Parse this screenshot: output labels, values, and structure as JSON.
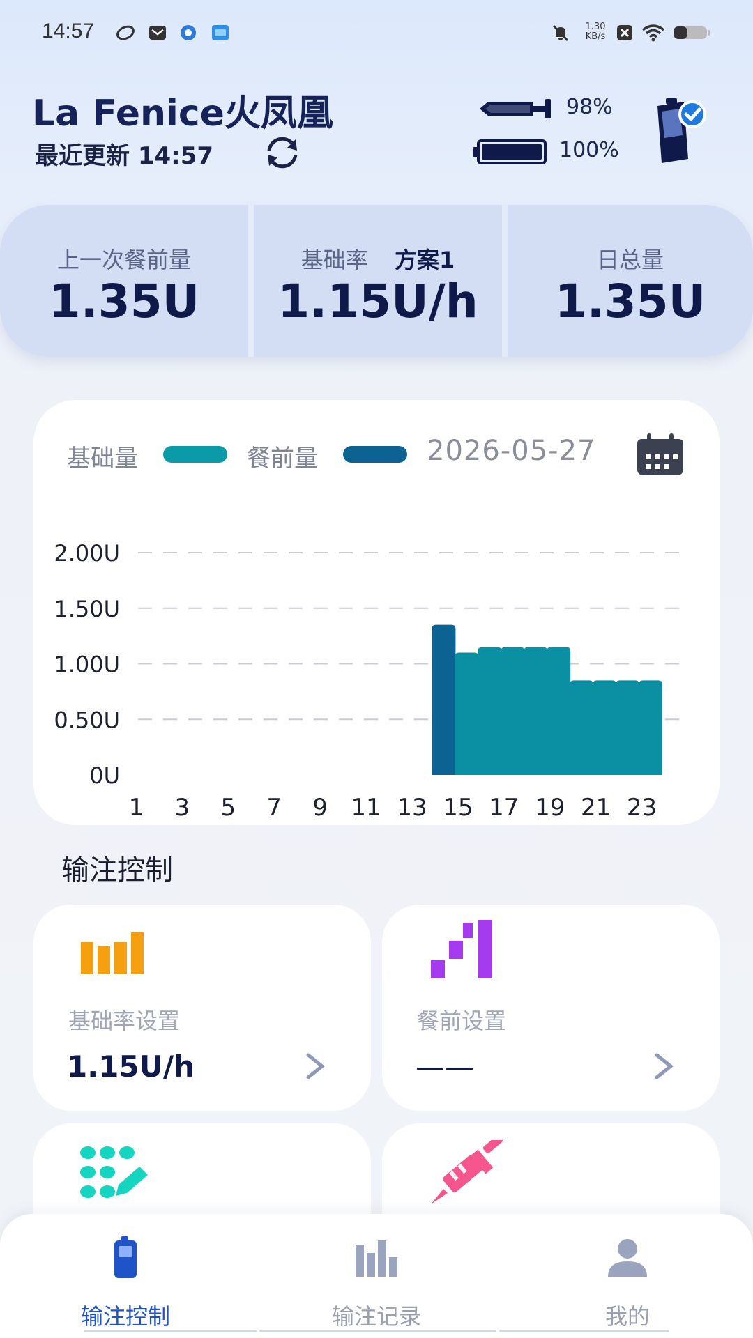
{
  "status_bar": {
    "time": "14:57",
    "net_speed_value": "1.30",
    "net_speed_unit": "KB/s"
  },
  "header": {
    "title": "La Fenice火凤凰",
    "last_update": "最近更新 14:57",
    "reservoir_pct": "98%",
    "battery_pct": "100%"
  },
  "summary": {
    "last_bolus": {
      "label": "上一次餐前量",
      "value": "1.35U"
    },
    "basal_rate": {
      "label": "基础率",
      "plan": "方案1",
      "value": "1.15U/h"
    },
    "daily_total": {
      "label": "日总量",
      "value": "1.35U"
    }
  },
  "chart_legend": {
    "basal": "基础量",
    "bolus": "餐前量",
    "date": "2026-05-27"
  },
  "colors": {
    "basal": "#0a8fa3",
    "bolus": "#0c6391",
    "accent": "#1f54c8",
    "orange": "#f5a011",
    "purple": "#a43bef",
    "teal": "#16d5c0",
    "pink": "#f6558e"
  },
  "chart_data": {
    "type": "bar",
    "ylim": [
      0,
      2.0
    ],
    "y_ticks": [
      "0U",
      "0.50U",
      "1.00U",
      "1.50U",
      "2.00U"
    ],
    "y_tick_values": [
      0,
      0.5,
      1.0,
      1.5,
      2.0
    ],
    "x_ticks": [
      "1",
      "3",
      "5",
      "7",
      "9",
      "11",
      "13",
      "15",
      "17",
      "19",
      "21",
      "23"
    ],
    "x_tick_values": [
      1,
      3,
      5,
      7,
      9,
      11,
      13,
      15,
      17,
      19,
      21,
      23
    ],
    "x_range": [
      0,
      24
    ],
    "series": [
      {
        "name": "餐前量",
        "bars": [
          {
            "x": 14,
            "y": 1.35
          }
        ]
      },
      {
        "name": "基础量",
        "bars": [
          {
            "x": 15,
            "y": 1.1
          },
          {
            "x": 16,
            "y": 1.15
          },
          {
            "x": 17,
            "y": 1.15
          },
          {
            "x": 18,
            "y": 1.15
          },
          {
            "x": 19,
            "y": 1.15
          },
          {
            "x": 20,
            "y": 0.85
          },
          {
            "x": 21,
            "y": 0.85
          },
          {
            "x": 22,
            "y": 0.85
          },
          {
            "x": 23,
            "y": 0.85
          }
        ]
      }
    ]
  },
  "section_title": "输注控制",
  "controls": {
    "basal_setting": {
      "label": "基础率设置",
      "value": "1.15U/h"
    },
    "bolus_setting": {
      "label": "餐前设置",
      "value": "——"
    }
  },
  "nav": {
    "infusion_control": "输注控制",
    "infusion_records": "输注记录",
    "mine": "我的"
  }
}
